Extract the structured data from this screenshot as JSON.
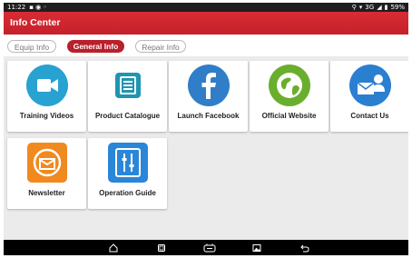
{
  "status": {
    "time": "11:22",
    "network": "3G",
    "battery": "59%"
  },
  "app": {
    "title": "Info Center"
  },
  "tabs": [
    {
      "label": "Equip Info",
      "active": false
    },
    {
      "label": "General Info",
      "active": true
    },
    {
      "label": "Repair Info",
      "active": false
    }
  ],
  "tiles": [
    {
      "label": "Training Videos",
      "icon": "video-icon",
      "color": "#27a2d1"
    },
    {
      "label": "Product Catalogue",
      "icon": "catalogue-icon",
      "color": "#1f95b2"
    },
    {
      "label": "Launch Facebook",
      "icon": "facebook-icon",
      "color": "#2f7ec7"
    },
    {
      "label": "Official Website",
      "icon": "globe-icon",
      "color": "#6aae2d"
    },
    {
      "label": "Contact Us",
      "icon": "contact-icon",
      "color": "#2b7fd0"
    },
    {
      "label": "Newsletter",
      "icon": "newsletter-icon",
      "color": "#f08a20"
    },
    {
      "label": "Operation Guide",
      "icon": "operation-guide-icon",
      "color": "#2a86d9"
    }
  ],
  "navbar": {
    "icons": [
      "home-icon",
      "overview-icon",
      "vci-icon",
      "screenshot-icon",
      "back-icon"
    ]
  }
}
